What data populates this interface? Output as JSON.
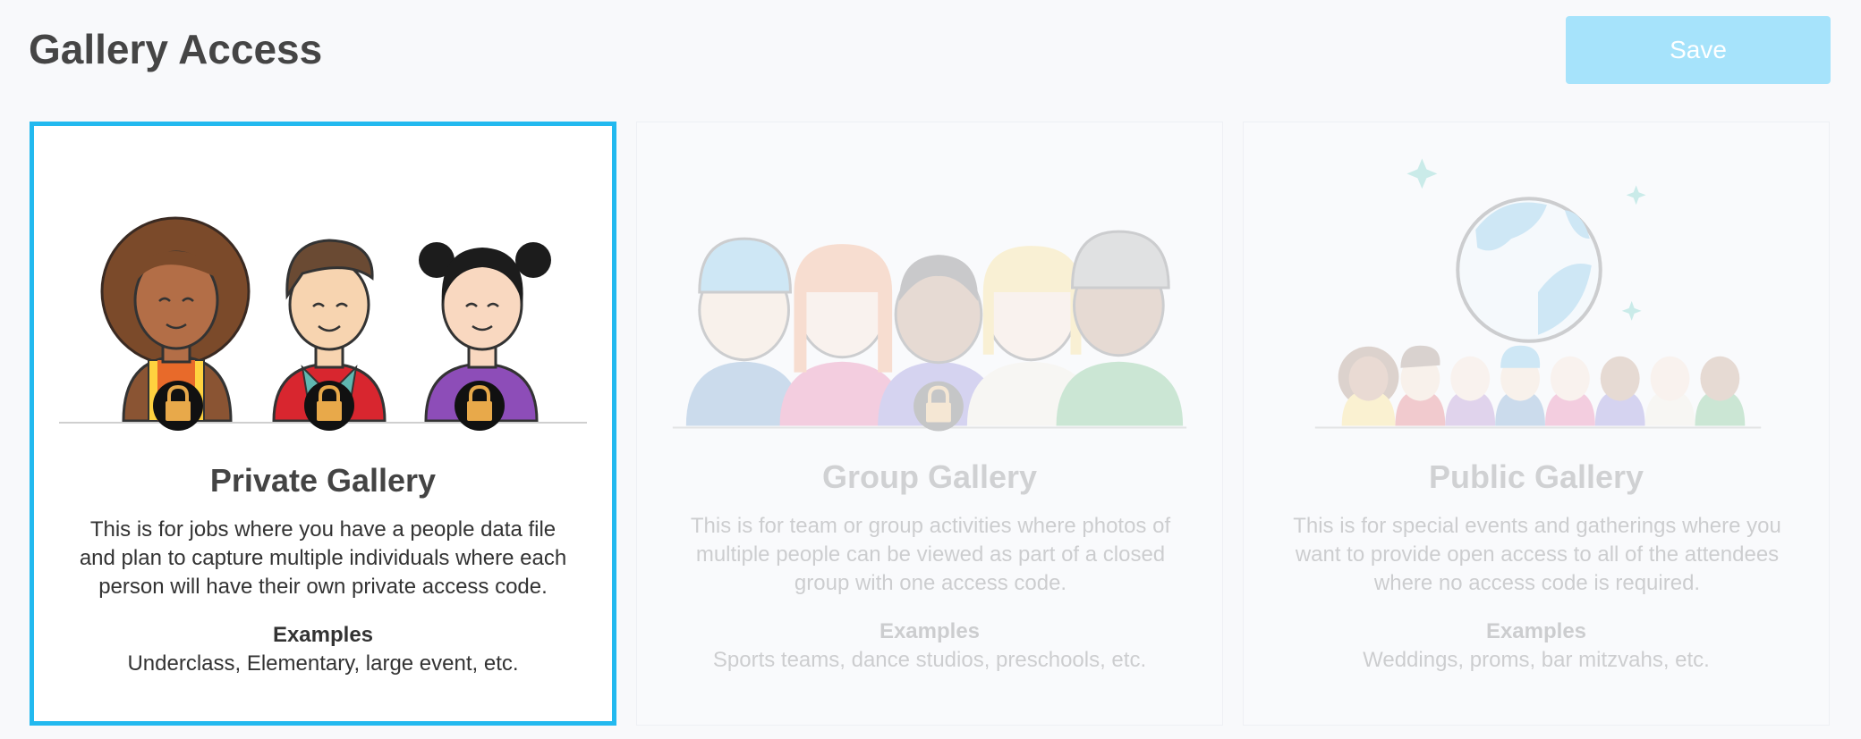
{
  "header": {
    "title": "Gallery Access",
    "save_label": "Save"
  },
  "cards": [
    {
      "title": "Private Gallery",
      "description": "This is for jobs where you have a people data file and plan to capture multiple individuals where each person will have their own private access code.",
      "examples_heading": "Examples",
      "examples": "Underclass, Elementary, large event, etc.",
      "selected": true
    },
    {
      "title": "Group Gallery",
      "description": "This is for team or group activities where photos of multiple people can be viewed as part of a closed group with one access code.",
      "examples_heading": "Examples",
      "examples": "Sports teams, dance studios, preschools, etc.",
      "selected": false
    },
    {
      "title": "Public Gallery",
      "description": "This is for special events and gatherings where you want to provide open access to all of the attendees where no access code is required.",
      "examples_heading": "Examples",
      "examples": "Weddings, proms, bar mitzvahs, etc.",
      "selected": false
    }
  ],
  "colors": {
    "accent": "#22b9ef",
    "save_bg": "#a6e3fb",
    "lock_gold": "#e8a94a"
  }
}
